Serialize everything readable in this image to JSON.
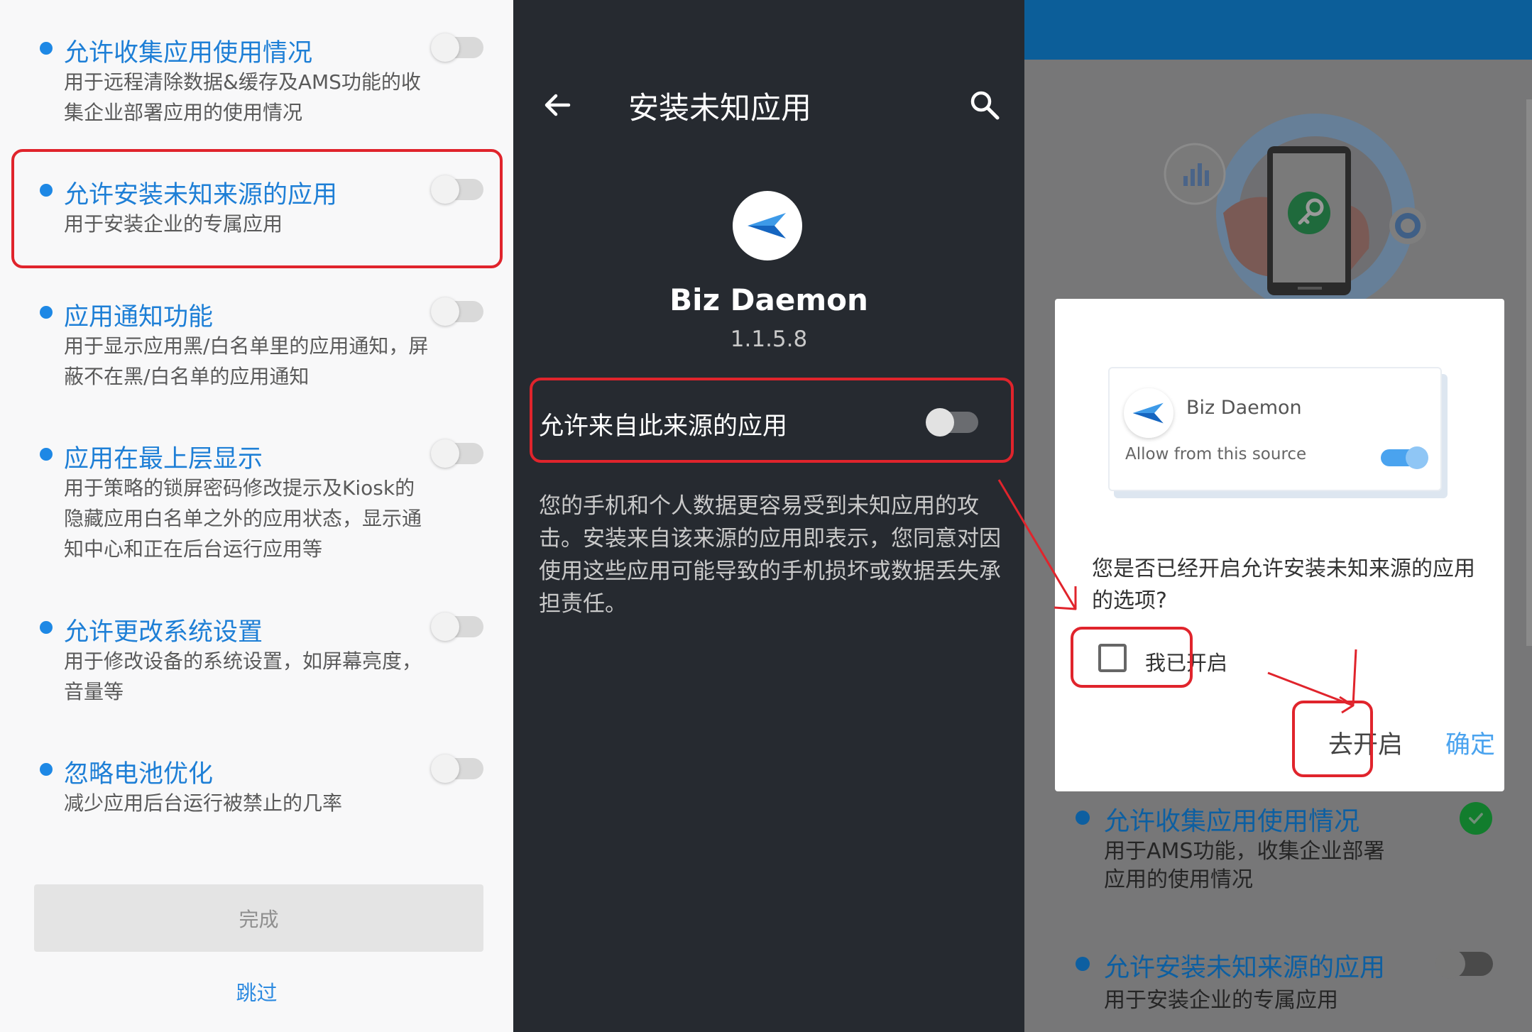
{
  "panel1": {
    "items": [
      {
        "title": "允许收集应用使用情况",
        "desc": "用于远程清除数据&缓存及AMS功能的收集企业部署应用的使用情况"
      },
      {
        "title": "允许安装未知来源的应用",
        "desc": "用于安装企业的专属应用"
      },
      {
        "title": "应用通知功能",
        "desc": "用于显示应用黑/白名单里的应用通知，屏蔽不在黑/白名单的应用通知"
      },
      {
        "title": "应用在最上层显示",
        "desc": "用于策略的锁屏密码修改提示及Kiosk的隐藏应用白名单之外的应用状态，显示通知中心和正在后台运行应用等"
      },
      {
        "title": "允许更改系统设置",
        "desc": "用于修改设备的系统设置，如屏幕亮度，音量等"
      },
      {
        "title": "忽略电池优化",
        "desc": "减少应用后台运行被禁止的几率"
      }
    ],
    "done_label": "完成",
    "skip_label": "跳过"
  },
  "panel2": {
    "title": "安装未知应用",
    "app_name": "Biz Daemon",
    "app_version": "1.1.5.8",
    "allow_label": "允许来自此来源的应用",
    "warning": "您的手机和个人数据更容易受到未知应用的攻击。安装来自该来源的应用即表示，您同意对因使用这些应用可能导致的手机损坏或数据丢失承担责任。"
  },
  "panel3": {
    "dialog": {
      "card_app_name": "Biz Daemon",
      "card_allow_label": "Allow from this source",
      "question": "您是否已经开启允许安装未知来源的应用的选项?",
      "checkbox_label": "我已开启",
      "go_label": "去开启",
      "ok_label": "确定"
    },
    "items": [
      {
        "title": "允许收集应用使用情况",
        "desc1": "用于AMS功能，收集企业部署",
        "desc2": "应用的使用情况"
      },
      {
        "title": "允许安装未知来源的应用",
        "desc1": "用于安装企业的专属应用"
      }
    ]
  },
  "colors": {
    "accent_blue": "#1e88e5",
    "highlight_red": "#e0242c",
    "dark_bg": "#262a30",
    "topbar_blue": "#0c5e99"
  }
}
